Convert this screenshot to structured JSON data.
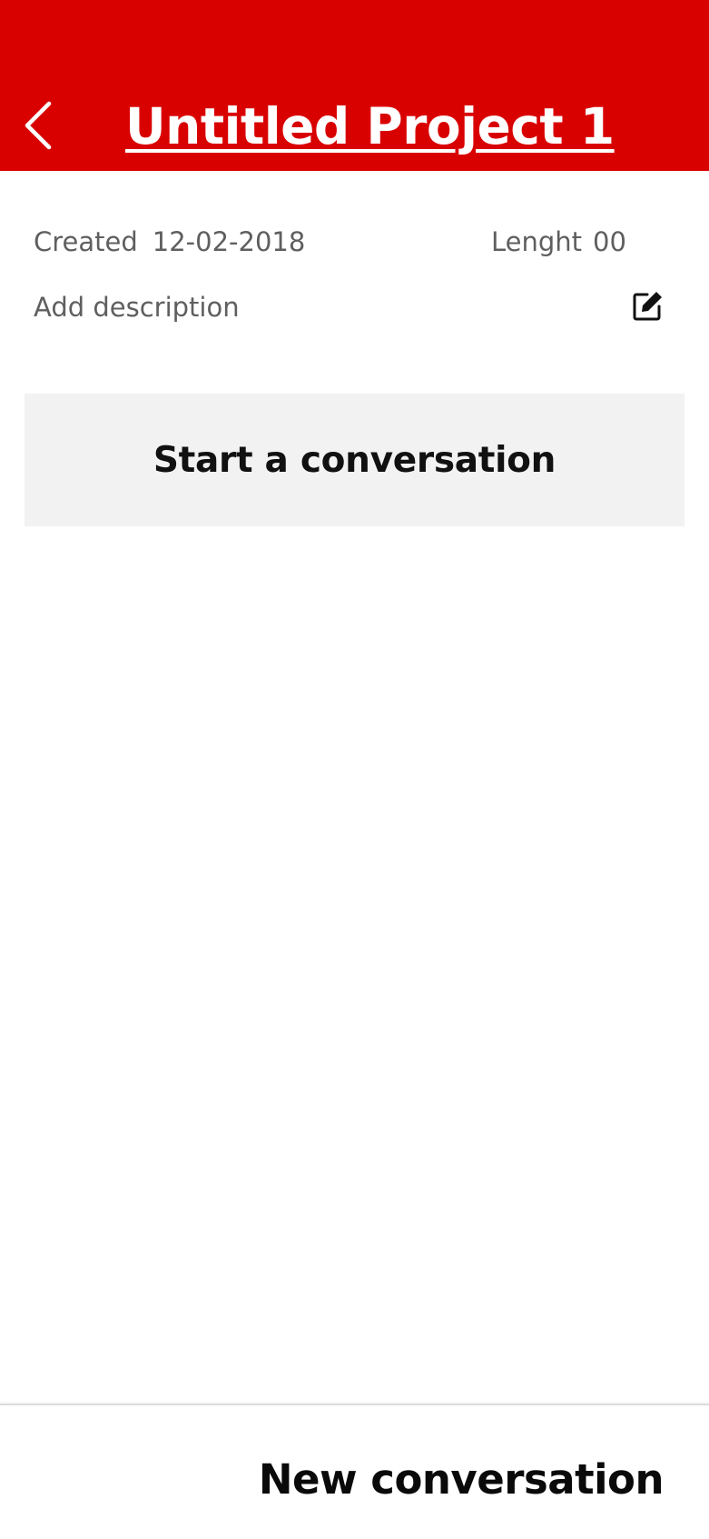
{
  "header": {
    "title": "Untitled Project 1",
    "back_icon": "chevron-left-icon",
    "background_color": "#d90000"
  },
  "project_meta": {
    "created_label": "Created",
    "created_value": "12-02-2018",
    "length_label": "Lenght",
    "length_value": "00"
  },
  "description": {
    "placeholder": "Add description",
    "edit_icon": "edit-icon"
  },
  "start_card": {
    "label": "Start a conversation"
  },
  "bottom_bar": {
    "action_label": "New conversation"
  }
}
